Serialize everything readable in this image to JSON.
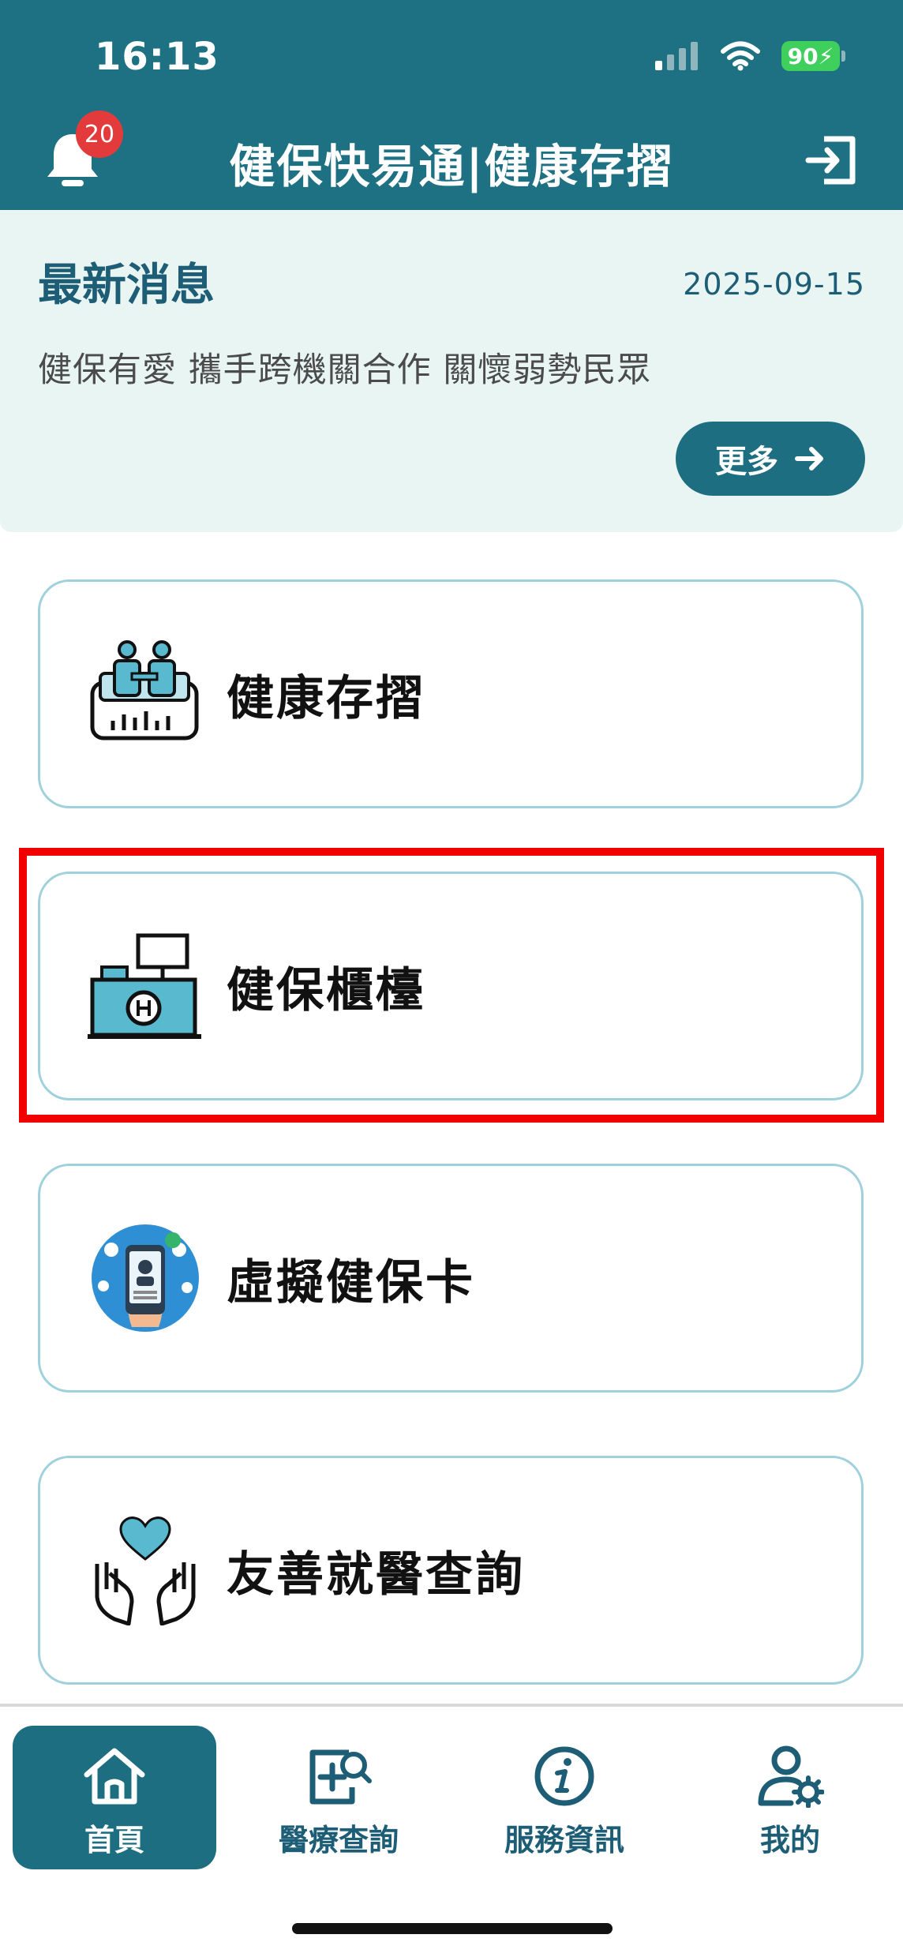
{
  "status_bar": {
    "time": "16:13",
    "battery": "90"
  },
  "header": {
    "title": "健保快易通|健康存摺",
    "notification_count": "20"
  },
  "news": {
    "heading": "最新消息",
    "date": "2025-09-15",
    "headline": "健保有愛 攜手跨機關合作 關懷弱勢民眾",
    "more_label": "更多"
  },
  "menu": [
    {
      "label": "健康存摺",
      "icon": "health-passbook-icon"
    },
    {
      "label": "健保櫃檯",
      "icon": "counter-icon",
      "highlighted": true
    },
    {
      "label": "虛擬健保卡",
      "icon": "virtual-card-icon"
    },
    {
      "label": "友善就醫查詢",
      "icon": "heart-hands-icon"
    }
  ],
  "tabbar": [
    {
      "label": "首頁",
      "icon": "home-icon",
      "active": true
    },
    {
      "label": "醫療查詢",
      "icon": "medical-search-icon",
      "active": false
    },
    {
      "label": "服務資訊",
      "icon": "info-icon",
      "active": false
    },
    {
      "label": "我的",
      "icon": "user-settings-icon",
      "active": false
    }
  ],
  "colors": {
    "primary": "#1e7183",
    "accent": "#1e6e82",
    "highlight": "#f20000",
    "news_bg": "#e8f5f3"
  }
}
